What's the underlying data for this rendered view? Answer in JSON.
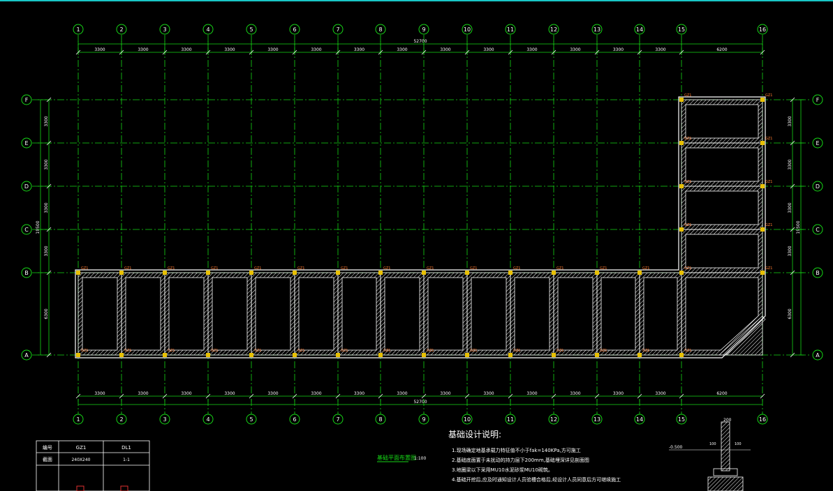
{
  "drawing": {
    "column_labels": [
      "1",
      "2",
      "3",
      "4",
      "5",
      "6",
      "7",
      "8",
      "9",
      "10",
      "11",
      "12",
      "13",
      "14",
      "15",
      "16"
    ],
    "row_labels": [
      "F",
      "E",
      "D",
      "C",
      "B",
      "A"
    ],
    "bay_spacing": [
      "3300",
      "3300",
      "3300",
      "3300",
      "3300",
      "3300",
      "3300",
      "3300",
      "3300",
      "3300",
      "3300",
      "3300",
      "3300",
      "3300",
      "6200"
    ],
    "overall_width": "52700",
    "row_spacing": [
      "3300",
      "3300",
      "3300",
      "3300",
      "6300"
    ],
    "overall_depth": "19500",
    "column_tag": "GZ1",
    "plan_title": "基础平面布置图",
    "plan_scale": "1:100"
  },
  "notes": {
    "heading": "基础设计说明:",
    "lines": [
      "1.现场确定地基承载力特征值不小于fak=140KPa,方可施工",
      "2.基础底面置于未扰动的持力层下200mm,基础埋深详见剖面图",
      "3.地圈梁以下采用MU10水泥砂浆MU10砌筑。",
      "4.基础开挖后,应及时通知设计人员验槽合格后,经设计人员同意后方可继续施工"
    ]
  },
  "schedule": {
    "col1_header": "编号",
    "col2_header": "GZ1",
    "col3_header": "DL1",
    "row1_label": "截面",
    "row1_col2": "240X240",
    "row1_col3": "1-1"
  },
  "section": {
    "level_label": "-0.500",
    "dim_top": "200",
    "dim_a": "100",
    "dim_b": "100"
  }
}
